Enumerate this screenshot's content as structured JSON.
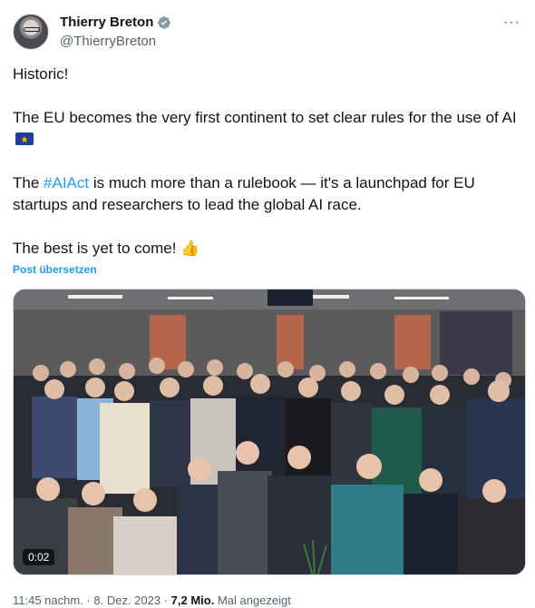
{
  "author": {
    "display_name": "Thierry Breton",
    "handle": "@ThierryBreton",
    "verified_icon": "verified-badge-icon"
  },
  "header": {
    "more_label": "···"
  },
  "tweet": {
    "line1": "Historic!",
    "line2": "The EU becomes the very first continent to set clear rules for the use of AI",
    "line3_pre": "The ",
    "hashtag": "#AIAct",
    "line3_post": " is much more than a rulebook — it's a launchpad for EU startups and researchers to lead the global AI race.",
    "line4": "The best is yet to come!",
    "flag_icon": "eu-flag-icon",
    "emoji_icon": "thumbs-up-icon"
  },
  "translate_label": "Post übersetzen",
  "media": {
    "duration": "0:02"
  },
  "meta": {
    "time": "11:45 nachm.",
    "sep1": " · ",
    "date": "8. Dez. 2023",
    "sep2": " · ",
    "views": "7,2 Mio.",
    "views_label": " Mal angezeigt"
  },
  "colors": {
    "link": "#1d9bf0",
    "muted": "#536471",
    "text": "#0f1419"
  }
}
